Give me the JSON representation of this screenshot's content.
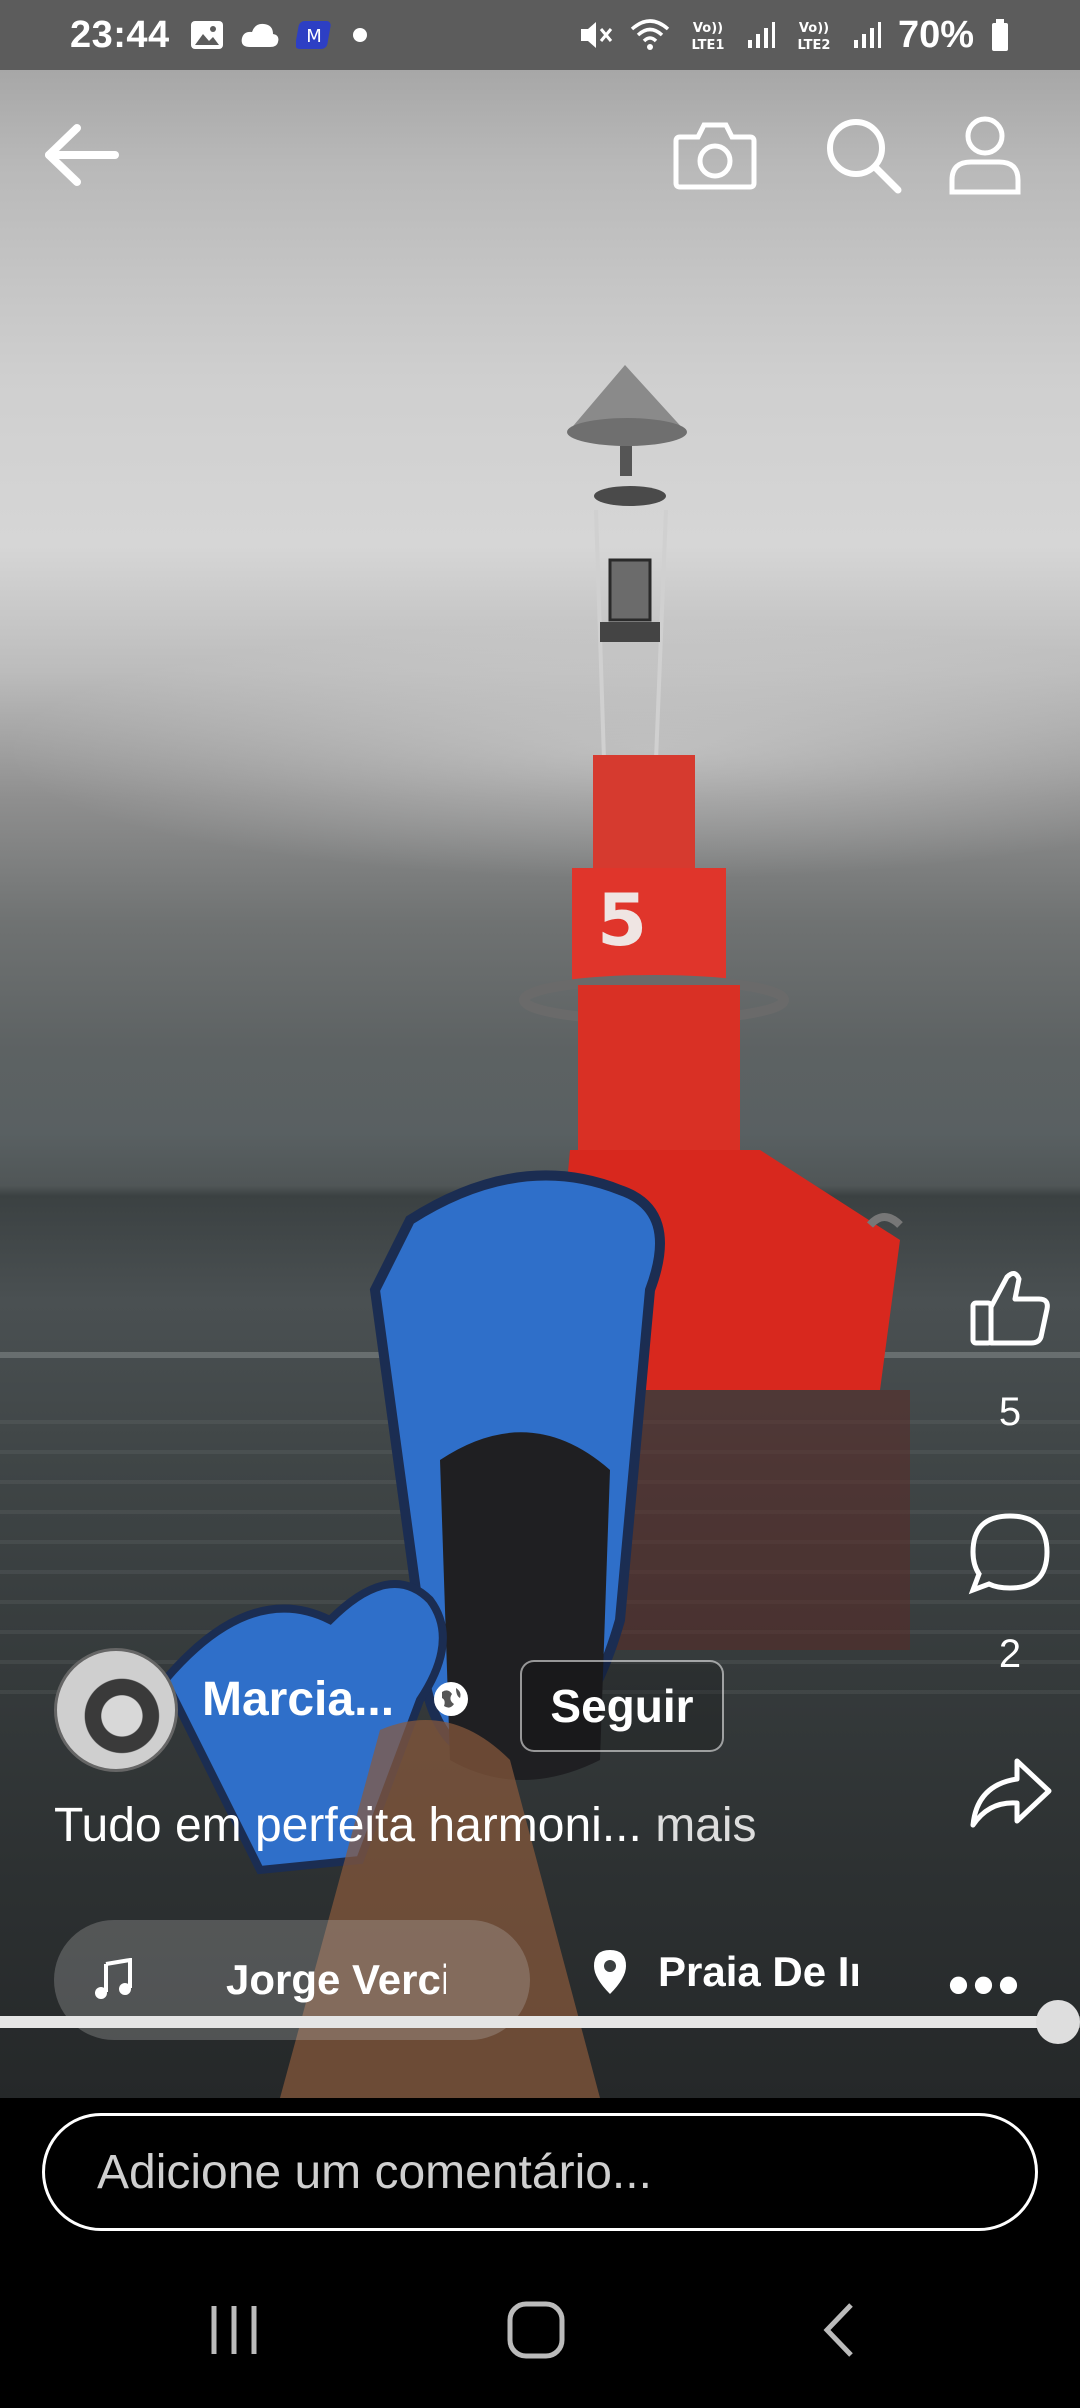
{
  "status_bar": {
    "time": "23:44",
    "battery": "70%",
    "icons": [
      "gallery-icon",
      "cloud-icon",
      "app-icon",
      "dot-icon",
      "mute-icon",
      "wifi-icon",
      "volte-lte1-icon",
      "signal-icon",
      "volte-lte2-icon",
      "signal-icon"
    ]
  },
  "top_bar": {
    "icons": [
      "back-arrow-icon",
      "camera-icon",
      "search-icon",
      "profile-icon"
    ]
  },
  "video": {
    "buoy_number": "5"
  },
  "actions": {
    "like_count": "5",
    "comment_count": "2"
  },
  "author": {
    "name": "Marcia...",
    "follow_label": "Seguir"
  },
  "caption": {
    "text": "Tudo em perfeita harmoni...",
    "more": "mais"
  },
  "music": {
    "label": "Jorge Verci"
  },
  "location": {
    "label": "Praia De Ir"
  },
  "progress": {
    "fraction": 0.985
  },
  "comment": {
    "placeholder": "Adicione um comentário..."
  },
  "colors": {
    "buoy_red": "#e0352b",
    "fin_blue": "#2f6fc9"
  }
}
